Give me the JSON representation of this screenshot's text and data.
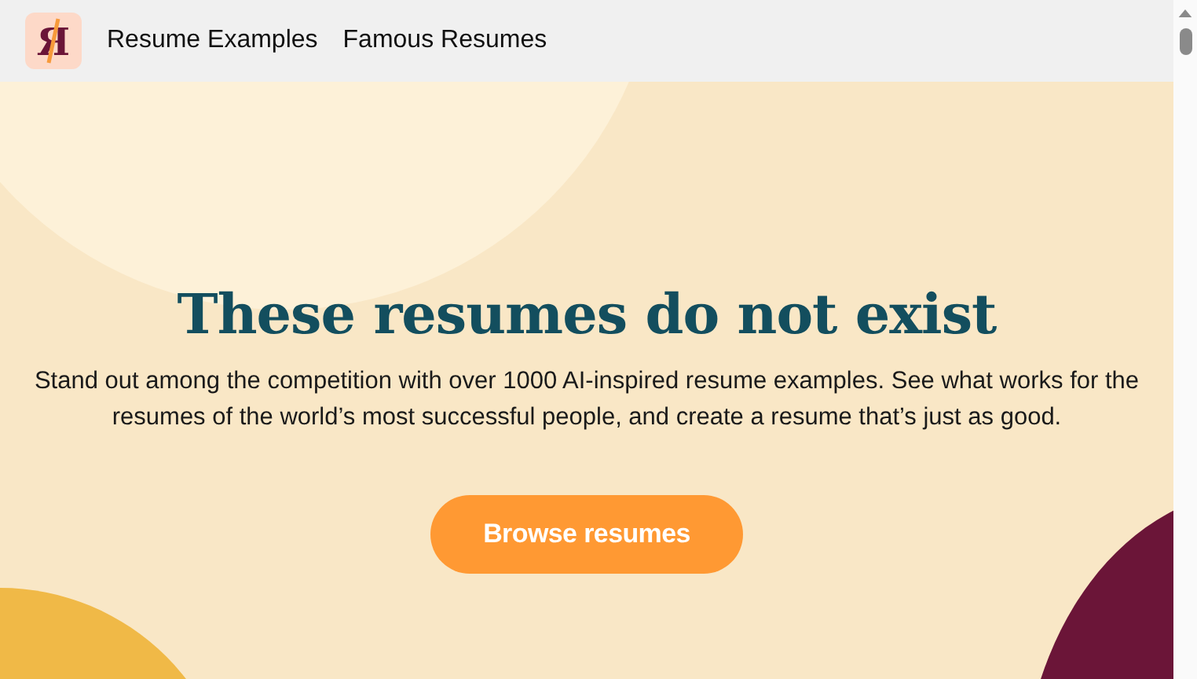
{
  "header": {
    "logo": "Я",
    "nav": [
      {
        "label": "Resume Examples"
      },
      {
        "label": "Famous Resumes"
      }
    ]
  },
  "hero": {
    "title": "These resumes do not exist",
    "text": "Stand out among the competition with over 1000 AI-inspired resume examples. See what works for the resumes of the world’s most successful people, and create a resume that’s just as good.",
    "button": "Browse resumes"
  }
}
